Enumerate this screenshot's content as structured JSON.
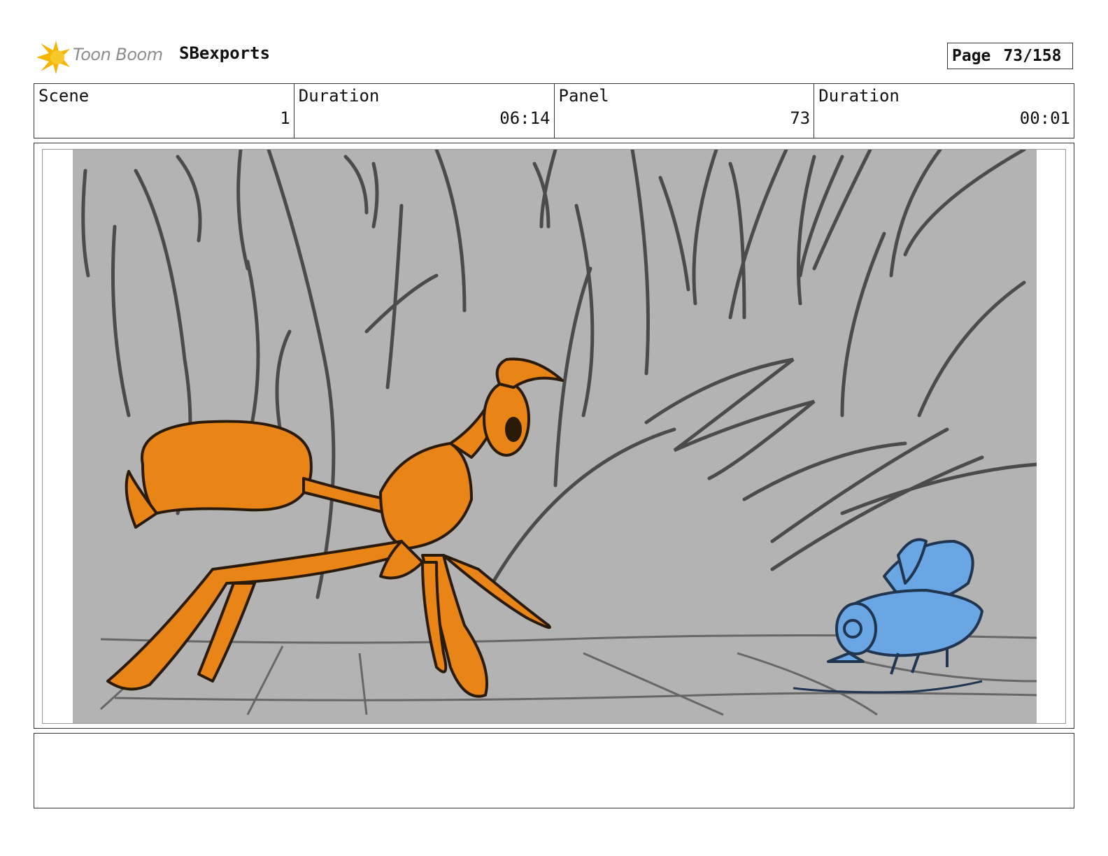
{
  "header": {
    "logo_text": "Toon Boom",
    "project_name": "SBexports",
    "page_label": "Page",
    "page_value": "73/158"
  },
  "info": {
    "scene_label": "Scene",
    "scene_value": "1",
    "scene_duration_label": "Duration",
    "scene_duration_value": "06:14",
    "panel_label": "Panel",
    "panel_value": "73",
    "panel_duration_label": "Duration",
    "panel_duration_value": "00:01"
  },
  "notes": {
    "text": ""
  },
  "colors": {
    "logo_flame": "#f5b400",
    "sketch_background": "#b3b3b3",
    "ant_orange": "#e98416",
    "fly_blue": "#6aa6e3"
  }
}
